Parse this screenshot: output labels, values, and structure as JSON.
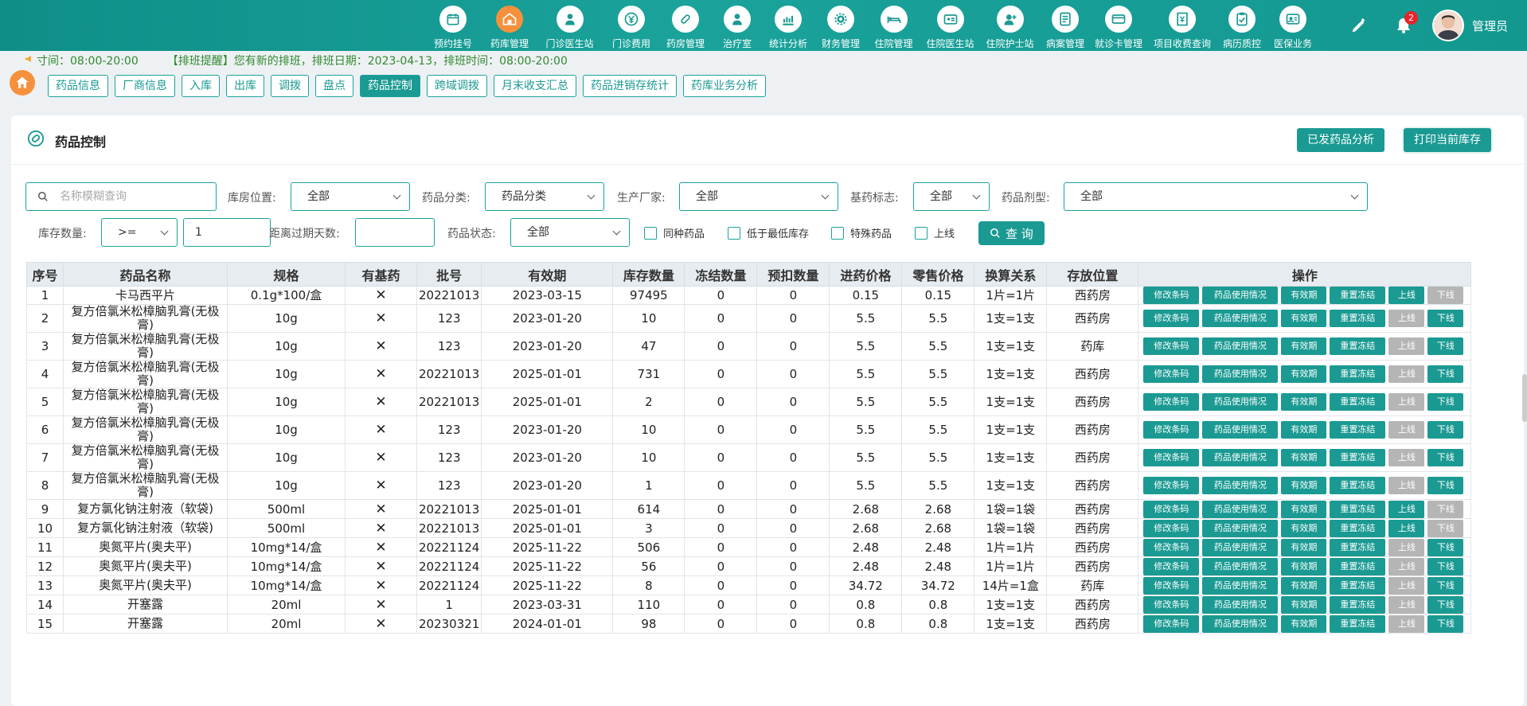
{
  "nav": [
    {
      "label": "预约挂号",
      "icon": "calendar-icon"
    },
    {
      "label": "药库管理",
      "icon": "warehouse-icon",
      "active": true
    },
    {
      "label": "门诊医生站",
      "icon": "doctor-icon"
    },
    {
      "label": "门诊费用",
      "icon": "yuan-icon"
    },
    {
      "label": "药房管理",
      "icon": "pill-icon"
    },
    {
      "label": "治疗室",
      "icon": "nurse-icon"
    },
    {
      "label": "统计分析",
      "icon": "chart-icon"
    },
    {
      "label": "财务管理",
      "icon": "gear-icon"
    },
    {
      "label": "住院管理",
      "icon": "bed-icon"
    },
    {
      "label": "住院医生站",
      "icon": "badge-icon"
    },
    {
      "label": "住院护士站",
      "icon": "nurse-badge-icon"
    },
    {
      "label": "病案管理",
      "icon": "record-icon"
    },
    {
      "label": "就诊卡管理",
      "icon": "card-icon"
    },
    {
      "label": "项目收费查询",
      "icon": "invoice-icon"
    },
    {
      "label": "病历质控",
      "icon": "clipboard-icon"
    },
    {
      "label": "医保业务",
      "icon": "insurance-icon"
    }
  ],
  "user": {
    "name": "管理员",
    "notifications": "2"
  },
  "notice": {
    "hours": "寸间：08:00-20:00",
    "message": "【排班提醒】您有新的排班，排班日期：2023-04-13，排班时间：08:00-20:00"
  },
  "subtabs": [
    {
      "label": "药品信息"
    },
    {
      "label": "厂商信息"
    },
    {
      "label": "入库"
    },
    {
      "label": "出库"
    },
    {
      "label": "调拨"
    },
    {
      "label": "盘点"
    },
    {
      "label": "药品控制",
      "active": true
    },
    {
      "label": "跨域调拨"
    },
    {
      "label": "月末收支汇总"
    },
    {
      "label": "药品进销存统计"
    },
    {
      "label": "药库业务分析"
    }
  ],
  "panel": {
    "title": "药品控制",
    "btn_analysis": "已发药品分析",
    "btn_print": "打印当前库存"
  },
  "filters": {
    "search_placeholder": "名称模糊查询",
    "storage_label": "库房位置:",
    "storage_value": "全部",
    "category_label": "药品分类:",
    "category_value": "药品分类",
    "maker_label": "生产厂家:",
    "maker_value": "全部",
    "basic_label": "基药标志:",
    "basic_value": "全部",
    "form_label": "药品剂型:",
    "form_value": "全部",
    "stock_label": "库存数量:",
    "stock_op": ">=",
    "stock_value": "1",
    "expiry_label": "距离过期天数:",
    "expiry_value": "",
    "status_label": "药品状态:",
    "status_value": "全部",
    "check_same": "同种药品",
    "check_low": "低于最低库存",
    "check_special": "特殊药品",
    "check_online": "上线",
    "query": "查 询"
  },
  "table": {
    "headers": [
      "序号",
      "药品名称",
      "规格",
      "有基药",
      "批号",
      "有效期",
      "库存数量",
      "冻结数量",
      "预扣数量",
      "进药价格",
      "零售价格",
      "换算关系",
      "存放位置",
      "操作"
    ],
    "op_labels": [
      "修改条码",
      "药品使用情况",
      "有效期",
      "重置冻结",
      "上线",
      "下线"
    ],
    "rows": [
      {
        "no": "1",
        "name": "卡马西平片",
        "spec": "0.1g*100/盒",
        "basic": "✕",
        "batch": "20221013",
        "expiry": "2023-03-15",
        "stock": "97495",
        "frozen": "0",
        "reserved": "0",
        "buy": "0.15",
        "retail": "0.15",
        "conv": "1片=1片",
        "loc": "西药房",
        "online": true
      },
      {
        "no": "2",
        "name": "复方倍氯米松樟脑乳膏(无极膏)",
        "spec": "10g",
        "basic": "✕",
        "batch": "123",
        "expiry": "2023-01-20",
        "stock": "10",
        "frozen": "0",
        "reserved": "0",
        "buy": "5.5",
        "retail": "5.5",
        "conv": "1支=1支",
        "loc": "西药房",
        "online": false
      },
      {
        "no": "3",
        "name": "复方倍氯米松樟脑乳膏(无极膏)",
        "spec": "10g",
        "basic": "✕",
        "batch": "123",
        "expiry": "2023-01-20",
        "stock": "47",
        "frozen": "0",
        "reserved": "0",
        "buy": "5.5",
        "retail": "5.5",
        "conv": "1支=1支",
        "loc": "药库",
        "online": false
      },
      {
        "no": "4",
        "name": "复方倍氯米松樟脑乳膏(无极膏)",
        "spec": "10g",
        "basic": "✕",
        "batch": "20221013",
        "expiry": "2025-01-01",
        "stock": "731",
        "frozen": "0",
        "reserved": "0",
        "buy": "5.5",
        "retail": "5.5",
        "conv": "1支=1支",
        "loc": "西药房",
        "online": false
      },
      {
        "no": "5",
        "name": "复方倍氯米松樟脑乳膏(无极膏)",
        "spec": "10g",
        "basic": "✕",
        "batch": "20221013",
        "expiry": "2025-01-01",
        "stock": "2",
        "frozen": "0",
        "reserved": "0",
        "buy": "5.5",
        "retail": "5.5",
        "conv": "1支=1支",
        "loc": "西药房",
        "online": false
      },
      {
        "no": "6",
        "name": "复方倍氯米松樟脑乳膏(无极膏)",
        "spec": "10g",
        "basic": "✕",
        "batch": "123",
        "expiry": "2023-01-20",
        "stock": "10",
        "frozen": "0",
        "reserved": "0",
        "buy": "5.5",
        "retail": "5.5",
        "conv": "1支=1支",
        "loc": "西药房",
        "online": false
      },
      {
        "no": "7",
        "name": "复方倍氯米松樟脑乳膏(无极膏)",
        "spec": "10g",
        "basic": "✕",
        "batch": "123",
        "expiry": "2023-01-20",
        "stock": "10",
        "frozen": "0",
        "reserved": "0",
        "buy": "5.5",
        "retail": "5.5",
        "conv": "1支=1支",
        "loc": "西药房",
        "online": false
      },
      {
        "no": "8",
        "name": "复方倍氯米松樟脑乳膏(无极膏)",
        "spec": "10g",
        "basic": "✕",
        "batch": "123",
        "expiry": "2023-01-20",
        "stock": "1",
        "frozen": "0",
        "reserved": "0",
        "buy": "5.5",
        "retail": "5.5",
        "conv": "1支=1支",
        "loc": "西药房",
        "online": false
      },
      {
        "no": "9",
        "name": "复方氯化钠注射液（软袋)",
        "spec": "500ml",
        "basic": "✕",
        "batch": "20221013",
        "expiry": "2025-01-01",
        "stock": "614",
        "frozen": "0",
        "reserved": "0",
        "buy": "2.68",
        "retail": "2.68",
        "conv": "1袋=1袋",
        "loc": "西药房",
        "online": true
      },
      {
        "no": "10",
        "name": "复方氯化钠注射液（软袋)",
        "spec": "500ml",
        "basic": "✕",
        "batch": "20221013",
        "expiry": "2025-01-01",
        "stock": "3",
        "frozen": "0",
        "reserved": "0",
        "buy": "2.68",
        "retail": "2.68",
        "conv": "1袋=1袋",
        "loc": "西药房",
        "online": true
      },
      {
        "no": "11",
        "name": "奥氮平片(奥夫平)",
        "spec": "10mg*14/盒",
        "basic": "✕",
        "batch": "20221124",
        "expiry": "2025-11-22",
        "stock": "506",
        "frozen": "0",
        "reserved": "0",
        "buy": "2.48",
        "retail": "2.48",
        "conv": "1片=1片",
        "loc": "西药房",
        "online": false
      },
      {
        "no": "12",
        "name": "奥氮平片(奥夫平)",
        "spec": "10mg*14/盒",
        "basic": "✕",
        "batch": "20221124",
        "expiry": "2025-11-22",
        "stock": "56",
        "frozen": "0",
        "reserved": "0",
        "buy": "2.48",
        "retail": "2.48",
        "conv": "1片=1片",
        "loc": "西药房",
        "online": false
      },
      {
        "no": "13",
        "name": "奥氮平片(奥夫平)",
        "spec": "10mg*14/盒",
        "basic": "✕",
        "batch": "20221124",
        "expiry": "2025-11-22",
        "stock": "8",
        "frozen": "0",
        "reserved": "0",
        "buy": "34.72",
        "retail": "34.72",
        "conv": "14片=1盒",
        "loc": "药库",
        "online": false
      },
      {
        "no": "14",
        "name": "开塞露",
        "spec": "20ml",
        "basic": "✕",
        "batch": "1",
        "expiry": "2023-03-31",
        "stock": "110",
        "frozen": "0",
        "reserved": "0",
        "buy": "0.8",
        "retail": "0.8",
        "conv": "1支=1支",
        "loc": "西药房",
        "online": false
      },
      {
        "no": "15",
        "name": "开塞露",
        "spec": "20ml",
        "basic": "✕",
        "batch": "20230321",
        "expiry": "2024-01-01",
        "stock": "98",
        "frozen": "0",
        "reserved": "0",
        "buy": "0.8",
        "retail": "0.8",
        "conv": "1支=1支",
        "loc": "西药房",
        "online": false
      }
    ]
  }
}
